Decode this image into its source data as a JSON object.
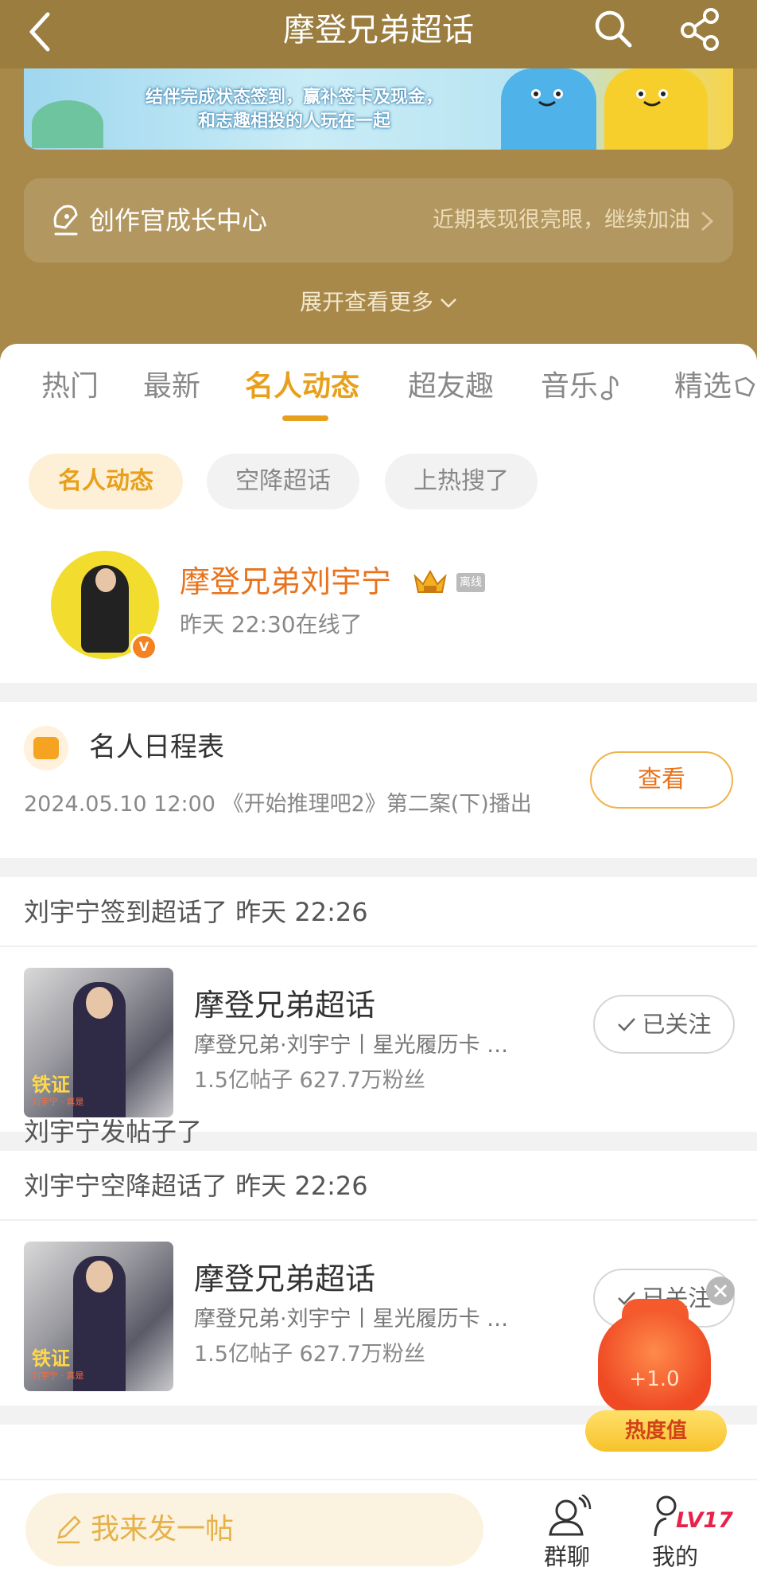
{
  "nav": {
    "title": "摩登兄弟超话"
  },
  "banner": {
    "line1": "结伴完成状态签到，赢补签卡及现金，",
    "line2": "和志趣相投的人玩在一起"
  },
  "growth": {
    "title": "创作官成长中心",
    "subtitle": "近期表现很亮眼，继续加油"
  },
  "expand": {
    "label": "展开查看更多"
  },
  "tabs": [
    {
      "label": "热门"
    },
    {
      "label": "最新"
    },
    {
      "label": "名人动态"
    },
    {
      "label": "超友趣"
    },
    {
      "label": "音乐"
    },
    {
      "label": "精选"
    }
  ],
  "chips": [
    {
      "label": "名人动态"
    },
    {
      "label": "空降超话"
    },
    {
      "label": "上热搜了"
    }
  ],
  "celebrity": {
    "name": "摩登兄弟刘宇宁",
    "offline_tag": "离线",
    "status": "昨天 22:30在线了",
    "verified": "V"
  },
  "schedule": {
    "title": "名人日程表",
    "detail": "2024.05.10 12:00 《开始推理吧2》第二案(下)播出",
    "button": "查看"
  },
  "activities": [
    {
      "header": "刘宇宁签到超话了 昨天 22:26",
      "topic_name": "摩登兄弟超话",
      "topic_desc": "摩登兄弟·刘宇宁丨星光履历卡 …",
      "stats": "1.5亿帖子  627.7万粉丝",
      "follow": "已关注",
      "thumb_label": "铁证",
      "thumb_sublabel": "刘宇宁 · 真是"
    },
    {
      "header": "刘宇宁空降超话了 昨天 22:26",
      "topic_name": "摩登兄弟超话",
      "topic_desc": "摩登兄弟·刘宇宁丨星光履历卡 …",
      "stats": "1.5亿帖子  627.7万粉丝",
      "follow": "已关注",
      "thumb_label": "铁证",
      "thumb_sublabel": "刘宇宁 · 真是"
    }
  ],
  "partial_header": "刘宇宁发帖子了",
  "heat": {
    "value": "+1.0",
    "label": "热度值"
  },
  "bottom": {
    "post": "我来发一帖",
    "groupchat": "群聊",
    "mine": "我的",
    "level": "LV17"
  }
}
